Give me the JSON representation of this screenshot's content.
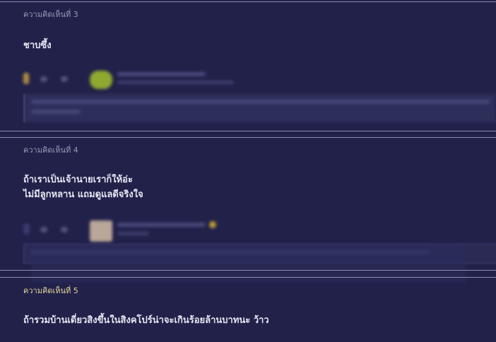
{
  "comments": [
    {
      "label": "ความคิดเห็นที่ 3",
      "lines": [
        "ชาบซึ้ง"
      ]
    },
    {
      "label": "ความคิดเห็นที่ 4",
      "lines": [
        "ถ้าเราเป็นเจ้านายเราก็ให้อ่ะ",
        "ไม่มีลูกหลาน แถมดูแลดีจริงใจ"
      ]
    },
    {
      "label": "ความคิดเห็นที่ 5",
      "lines": [
        "ถ้ารวมบ้านเดี่ยวสิงขึ้นในสิงคโปร์น่าจะเกินร้อยล้านบาทนะ ว้าว"
      ]
    }
  ],
  "colors": {
    "background": "#21214a",
    "label": "#9a9ab8",
    "label_highlight": "#e8d79a",
    "text": "#e6e6f2",
    "divider": "#8b8bb0"
  },
  "icons": [
    "member-badge-icon",
    "vote-up-icon",
    "vote-down-icon",
    "avatar"
  ]
}
